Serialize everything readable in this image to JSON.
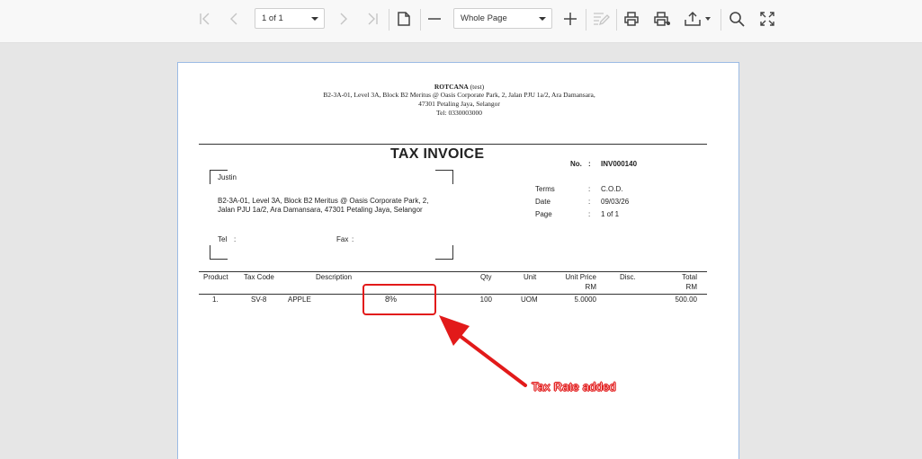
{
  "toolbar": {
    "page_indicator": "1 of 1",
    "zoom_mode": "Whole Page"
  },
  "company": {
    "name": "ROTCANA",
    "name_suffix": "(test)",
    "address_line1": "B2-3A-01, Level 3A, Block B2 Meritus @ Oasis Corporate Park, 2, Jalan PJU 1a/2, Ara Damansara,",
    "address_line2": "47301 Petaling Jaya, Selangor",
    "tel": "Tel: 0330003000"
  },
  "invoice": {
    "title": "TAX INVOICE",
    "no_label": "No.",
    "no_sep": ":",
    "no_value": "INV000140",
    "customer_name": "Justin",
    "customer_address1": "B2-3A-01, Level 3A, Block B2 Meritus @ Oasis Corporate Park, 2,",
    "customer_address2": "Jalan PJU 1a/2, Ara Damansara, 47301 Petaling Jaya, Selangor",
    "tel_label": "Tel",
    "fax_label": "Fax",
    "colon": ":",
    "terms_label": "Terms",
    "terms_value": "C.O.D.",
    "date_label": "Date",
    "date_value": "09/03/26",
    "page_label": "Page",
    "page_value": "1 of 1"
  },
  "table": {
    "headers": {
      "product": "Product",
      "tax_code": "Tax Code",
      "description": "Description",
      "qty": "Qty",
      "unit": "Unit",
      "unit_price": "Unit Price",
      "unit_price_sub": "RM",
      "disc": "Disc.",
      "total": "Total",
      "total_sub": "RM"
    },
    "rows": [
      {
        "product": "1.",
        "tax_code": "SV-8",
        "description": "APPLE",
        "tax_rate": "8%",
        "qty": "100",
        "unit": "UOM",
        "unit_price": "5.0000",
        "disc": "",
        "total": "500.00"
      }
    ]
  },
  "annotation": {
    "label": "Tax Rate added",
    "color": "#e21a1a"
  }
}
